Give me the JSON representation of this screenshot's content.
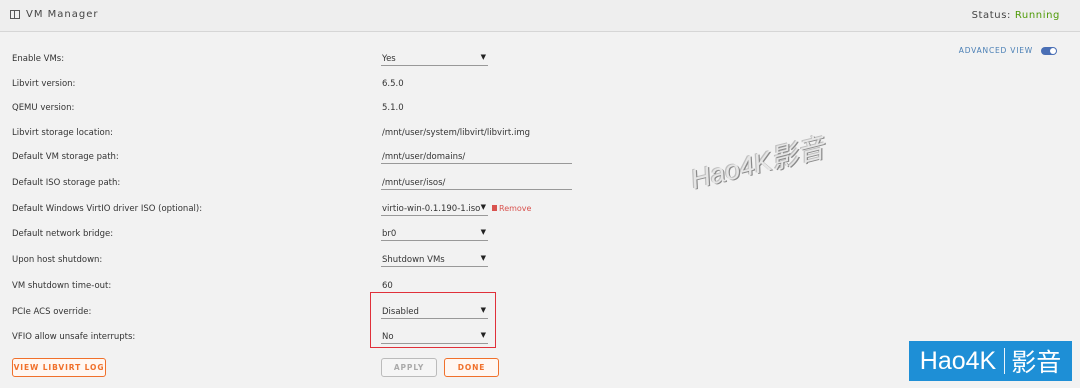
{
  "window": {
    "title": "VM Manager",
    "status_label": "Status:",
    "status_value": "Running",
    "status_color": "#4e9a06"
  },
  "advanced_view": {
    "label": "ADVANCED VIEW",
    "enabled": true
  },
  "settings": {
    "enable_vms": {
      "label": "Enable VMs:",
      "value": "Yes"
    },
    "libvirt_version": {
      "label": "Libvirt version:",
      "value": "6.5.0"
    },
    "qemu_version": {
      "label": "QEMU version:",
      "value": "5.1.0"
    },
    "libvirt_storage": {
      "label": "Libvirt storage location:",
      "value": "/mnt/user/system/libvirt/libvirt.img"
    },
    "vm_storage_path": {
      "label": "Default VM storage path:",
      "value": "/mnt/user/domains/"
    },
    "iso_storage_path": {
      "label": "Default ISO storage path:",
      "value": "/mnt/user/isos/"
    },
    "virtio_iso": {
      "label": "Default Windows VirtIO driver ISO (optional):",
      "value": "virtio-win-0.1.190-1.iso",
      "remove_label": "Remove"
    },
    "network_bridge": {
      "label": "Default network bridge:",
      "value": "br0"
    },
    "host_shutdown": {
      "label": "Upon host shutdown:",
      "value": "Shutdown VMs"
    },
    "shutdown_timeout": {
      "label": "VM shutdown time-out:",
      "value": "60"
    },
    "pcie_acs": {
      "label": "PCIe ACS override:",
      "value": "Disabled"
    },
    "vfio_unsafe": {
      "label": "VFIO allow unsafe interrupts:",
      "value": "No"
    }
  },
  "buttons": {
    "view_log": "VIEW LIBVIRT LOG",
    "apply": "APPLY",
    "done": "DONE"
  },
  "watermark": {
    "center_text": "Hao4K影音",
    "badge_left": "Hao4K",
    "badge_right": "影音"
  },
  "colors": {
    "accent_orange": "#f0702b",
    "highlight_red": "#e0303a",
    "link_blue": "#4a7fb5",
    "badge_blue": "#1e8fd6"
  }
}
